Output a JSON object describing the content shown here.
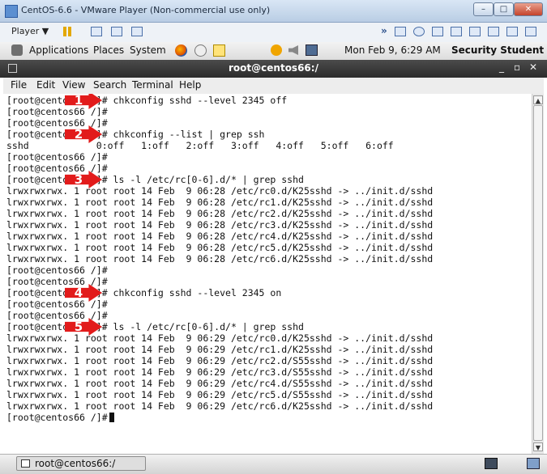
{
  "vmware": {
    "title": "CentOS-6.6 - VMware Player (Non-commercial use only)",
    "player_menu": "Player ▼",
    "min_btn": "–",
    "max_btn": "□",
    "close_btn": "✕",
    "more_icon": "»"
  },
  "panel": {
    "applications": "Applications",
    "places": "Places",
    "system": "System",
    "datetime": "Mon Feb  9,  6:29 AM",
    "user": "Security Student"
  },
  "terminal": {
    "title": "root@centos66:/",
    "minimize": "_",
    "maximize": "▫",
    "close": "✕",
    "menu": [
      "File",
      "Edit",
      "View",
      "Search",
      "Terminal",
      "Help"
    ],
    "lines": [
      "[root@centos66 /]# chkconfig sshd --level 2345 off",
      "[root@centos66 /]#",
      "[root@centos66 /]#",
      "[root@centos66 /]# chkconfig --list | grep ssh",
      "sshd            0:off   1:off   2:off   3:off   4:off   5:off   6:off",
      "[root@centos66 /]#",
      "[root@centos66 /]#",
      "[root@centos66 /]# ls -l /etc/rc[0-6].d/* | grep sshd",
      "lrwxrwxrwx. 1 root root 14 Feb  9 06:28 /etc/rc0.d/K25sshd -> ../init.d/sshd",
      "lrwxrwxrwx. 1 root root 14 Feb  9 06:28 /etc/rc1.d/K25sshd -> ../init.d/sshd",
      "lrwxrwxrwx. 1 root root 14 Feb  9 06:28 /etc/rc2.d/K25sshd -> ../init.d/sshd",
      "lrwxrwxrwx. 1 root root 14 Feb  9 06:28 /etc/rc3.d/K25sshd -> ../init.d/sshd",
      "lrwxrwxrwx. 1 root root 14 Feb  9 06:28 /etc/rc4.d/K25sshd -> ../init.d/sshd",
      "lrwxrwxrwx. 1 root root 14 Feb  9 06:28 /etc/rc5.d/K25sshd -> ../init.d/sshd",
      "lrwxrwxrwx. 1 root root 14 Feb  9 06:28 /etc/rc6.d/K25sshd -> ../init.d/sshd",
      "[root@centos66 /]#",
      "[root@centos66 /]#",
      "[root@centos66 /]# chkconfig sshd --level 2345 on",
      "[root@centos66 /]#",
      "[root@centos66 /]#",
      "[root@centos66 /]# ls -l /etc/rc[0-6].d/* | grep sshd",
      "lrwxrwxrwx. 1 root root 14 Feb  9 06:29 /etc/rc0.d/K25sshd -> ../init.d/sshd",
      "lrwxrwxrwx. 1 root root 14 Feb  9 06:29 /etc/rc1.d/K25sshd -> ../init.d/sshd",
      "lrwxrwxrwx. 1 root root 14 Feb  9 06:29 /etc/rc2.d/S55sshd -> ../init.d/sshd",
      "lrwxrwxrwx. 1 root root 14 Feb  9 06:29 /etc/rc3.d/S55sshd -> ../init.d/sshd",
      "lrwxrwxrwx. 1 root root 14 Feb  9 06:29 /etc/rc4.d/S55sshd -> ../init.d/sshd",
      "lrwxrwxrwx. 1 root root 14 Feb  9 06:29 /etc/rc5.d/S55sshd -> ../init.d/sshd",
      "lrwxrwxrwx. 1 root root 14 Feb  9 06:29 /etc/rc6.d/K25sshd -> ../init.d/sshd",
      "[root@centos66 /]#"
    ],
    "scroll_up": "▲",
    "scroll_down": "▼"
  },
  "annotations": [
    "1",
    "2",
    "3",
    "4",
    "5"
  ],
  "taskbar": {
    "task_label": "root@centos66:/"
  }
}
